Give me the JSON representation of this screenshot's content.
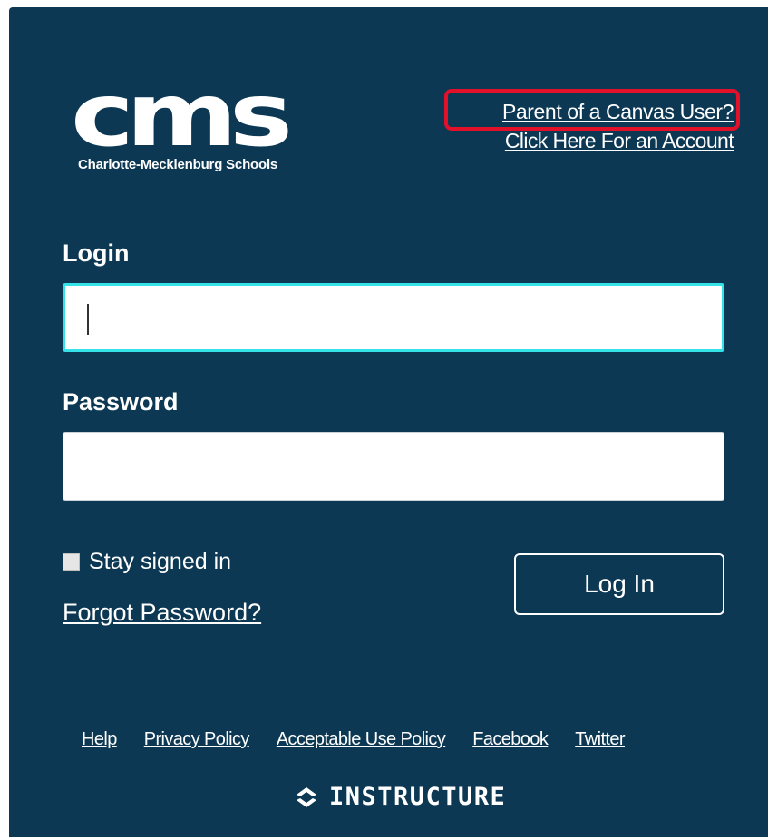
{
  "header": {
    "logo_mark": "cms",
    "logo_subtitle": "Charlotte-Mecklenburg Schools",
    "parent_link": "Parent of a Canvas User?",
    "account_link": "Click Here For an Account"
  },
  "form": {
    "login_label": "Login",
    "login_value": "",
    "password_label": "Password",
    "password_value": "",
    "stay_signed_in": "Stay signed in",
    "stay_signed_in_checked": false,
    "forgot_password": "Forgot Password?",
    "login_button": "Log In"
  },
  "footer": {
    "links": [
      "Help",
      "Privacy Policy",
      "Acceptable Use Policy",
      "Facebook",
      "Twitter"
    ],
    "brand": "INSTRUCTURE"
  },
  "colors": {
    "panel_background": "#0c3854",
    "focus_border": "#35e2e8",
    "highlight": "#e3102a"
  },
  "icons": {
    "brand_icon": "instructure-chevrons-icon"
  }
}
